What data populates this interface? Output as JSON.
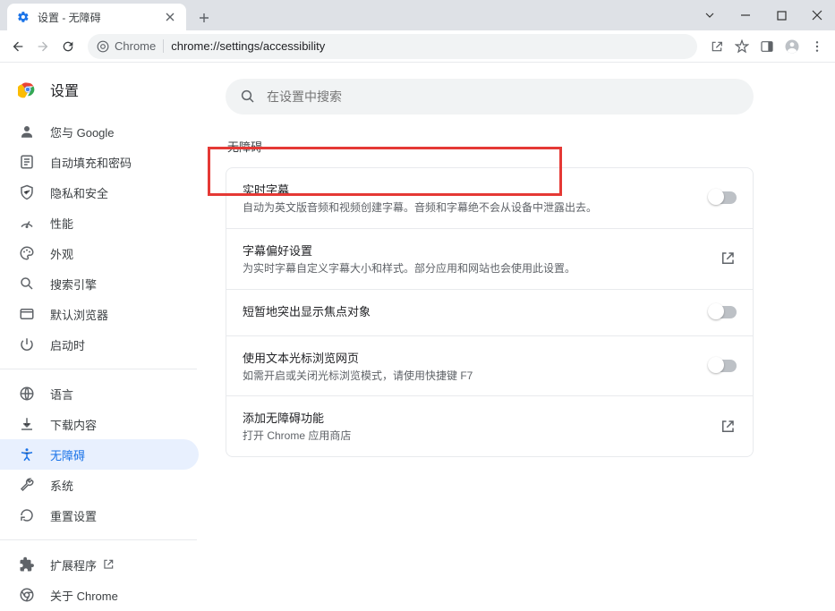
{
  "window": {
    "tab_title": "设置 - 无障碍"
  },
  "omnibox": {
    "chip_label": "Chrome",
    "url": "chrome://settings/accessibility"
  },
  "sidebar": {
    "header": "设置",
    "items_top": [
      {
        "label": "您与 Google",
        "icon": "person-icon"
      },
      {
        "label": "自动填充和密码",
        "icon": "autofill-icon"
      },
      {
        "label": "隐私和安全",
        "icon": "shield-icon"
      },
      {
        "label": "性能",
        "icon": "speed-icon"
      },
      {
        "label": "外观",
        "icon": "palette-icon"
      },
      {
        "label": "搜索引擎",
        "icon": "search-icon"
      },
      {
        "label": "默认浏览器",
        "icon": "browser-icon"
      },
      {
        "label": "启动时",
        "icon": "power-icon"
      }
    ],
    "items_mid": [
      {
        "label": "语言",
        "icon": "globe-icon"
      },
      {
        "label": "下载内容",
        "icon": "download-icon"
      },
      {
        "label": "无障碍",
        "icon": "accessibility-icon",
        "active": true
      },
      {
        "label": "系统",
        "icon": "wrench-icon"
      },
      {
        "label": "重置设置",
        "icon": "reset-icon"
      }
    ],
    "items_bottom": [
      {
        "label": "扩展程序",
        "icon": "extension-icon",
        "external": true
      },
      {
        "label": "关于 Chrome",
        "icon": "chrome-icon"
      }
    ]
  },
  "main": {
    "search_placeholder": "在设置中搜索",
    "section_title": "无障碍",
    "rows": [
      {
        "title": "实时字幕",
        "sub": "自动为英文版音频和视频创建字幕。音频和字幕绝不会从设备中泄露出去。",
        "action": "toggle"
      },
      {
        "title": "字幕偏好设置",
        "sub": "为实时字幕自定义字幕大小和样式。部分应用和网站也会使用此设置。",
        "action": "link"
      },
      {
        "title": "短暂地突出显示焦点对象",
        "sub": "",
        "action": "toggle"
      },
      {
        "title": "使用文本光标浏览网页",
        "sub": "如需开启或关闭光标浏览模式，请使用快捷键 F7",
        "action": "toggle"
      },
      {
        "title": "添加无障碍功能",
        "sub": "打开 Chrome 应用商店",
        "action": "link"
      }
    ]
  }
}
